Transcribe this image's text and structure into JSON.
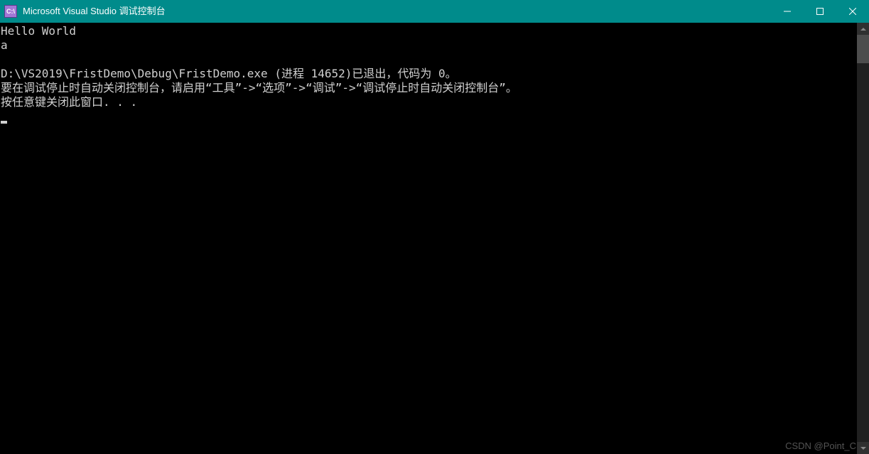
{
  "window": {
    "icon_text": "C:\\",
    "title": "Microsoft Visual Studio 调试控制台"
  },
  "console": {
    "lines": [
      "Hello World",
      "a",
      "",
      "D:\\VS2019\\FristDemo\\Debug\\FristDemo.exe (进程 14652)已退出，代码为 0。",
      "要在调试停止时自动关闭控制台，请启用“工具”->“选项”->“调试”->“调试停止时自动关闭控制台”。",
      "按任意键关闭此窗口. . ."
    ]
  },
  "watermark": "CSDN @Point_C"
}
